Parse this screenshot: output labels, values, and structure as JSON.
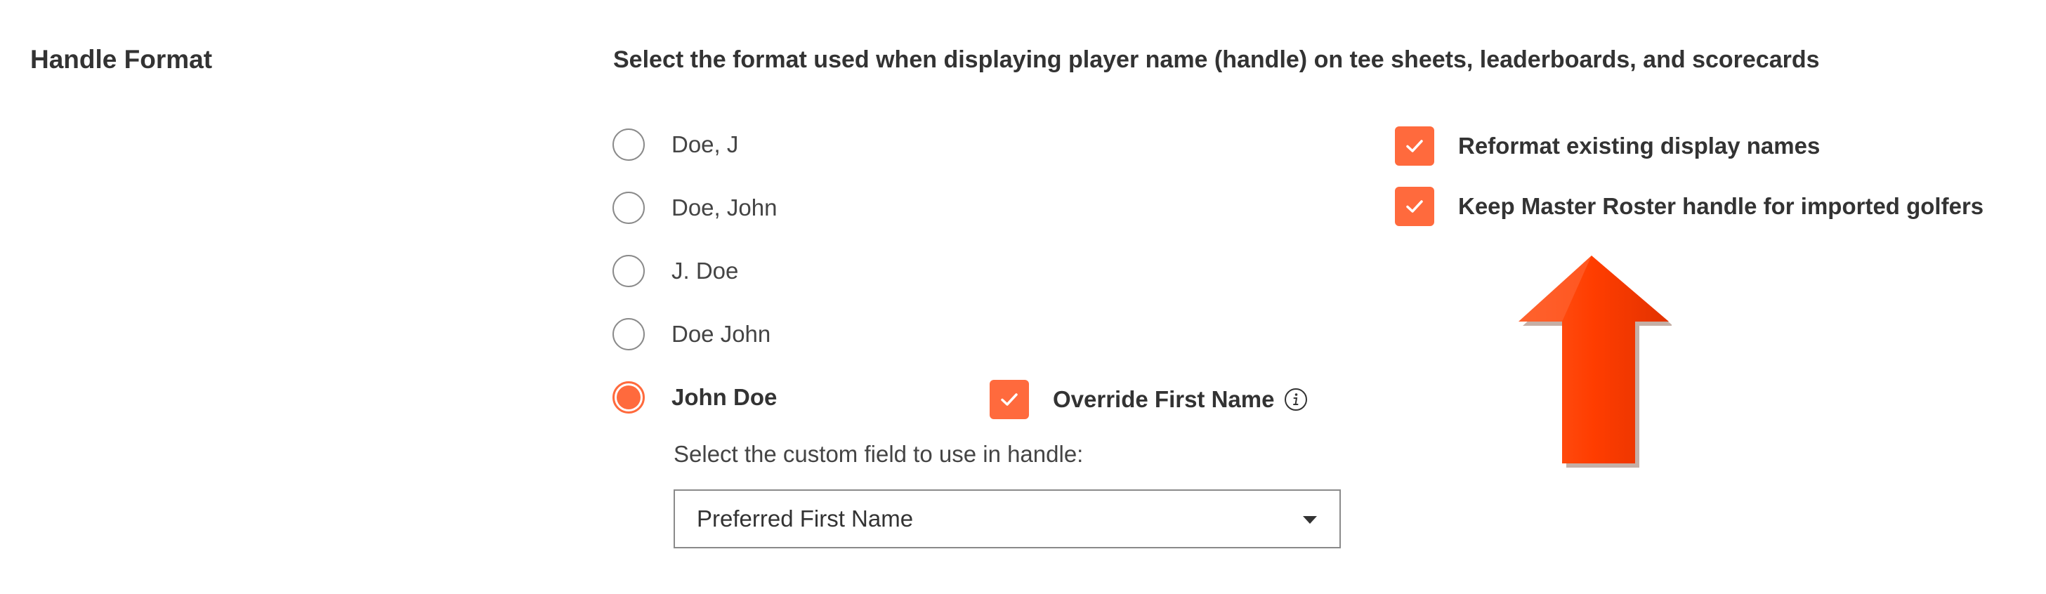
{
  "section": {
    "title": "Handle Format",
    "description": "Select the format used when displaying player name (handle) on tee sheets, leaderboards, and scorecards"
  },
  "handle_options": [
    {
      "label": "Doe, J",
      "selected": false
    },
    {
      "label": "Doe, John",
      "selected": false
    },
    {
      "label": "J. Doe",
      "selected": false
    },
    {
      "label": "Doe John",
      "selected": false
    },
    {
      "label": "John Doe",
      "selected": true
    }
  ],
  "override_first_name": {
    "label": "Override First Name",
    "checked": true,
    "icon": "info-icon"
  },
  "custom_field": {
    "label": "Select the custom field to use in handle:",
    "selected_value": "Preferred First Name",
    "icon": "chevron-down-icon"
  },
  "options": [
    {
      "label": "Reformat existing display names",
      "checked": true
    },
    {
      "label": "Keep Master Roster handle for imported golfers",
      "checked": true
    }
  ],
  "annotation": {
    "icon": "red-up-arrow-icon",
    "color": "#ff3d00"
  },
  "colors": {
    "accent": "#ff6a3d",
    "text": "#333333",
    "border": "#8a8a8a"
  }
}
